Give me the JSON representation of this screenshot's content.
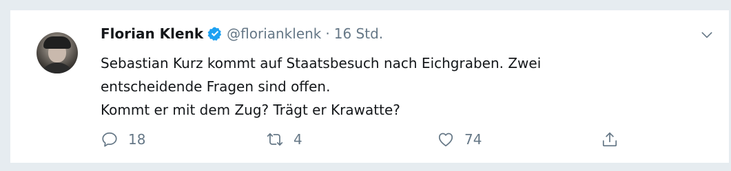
{
  "tweet": {
    "author_name": "Florian Klenk",
    "handle": "@florianklenk",
    "separator": "·",
    "time": "16 Std.",
    "text_line1": "Sebastian Kurz kommt auf Staatsbesuch nach Eichgraben. Zwei",
    "text_line2": "entscheidende Fragen sind offen.",
    "text_line3": "Kommt er mit dem Zug? Trägt er Krawatte?"
  },
  "actions": {
    "reply_count": "18",
    "retweet_count": "4",
    "like_count": "74"
  },
  "icons": {
    "verified": "verified-badge-icon",
    "menu": "chevron-down-icon",
    "reply": "speech-bubble-icon",
    "retweet": "retweet-arrows-icon",
    "like": "heart-icon",
    "share": "share-upload-icon"
  },
  "colors": {
    "verified_blue": "#1da1f2",
    "text_gray": "#657786",
    "text_dark": "#14171a"
  }
}
